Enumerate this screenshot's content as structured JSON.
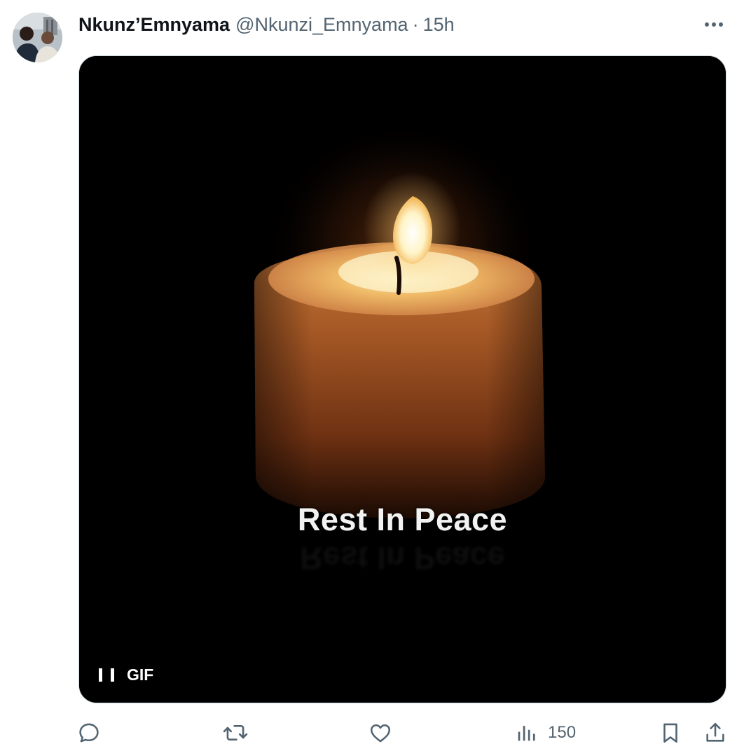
{
  "tweet": {
    "display_name": "Nkunz’Emnyama",
    "handle": "@Nkunzi_Emnyama",
    "separator": "·",
    "time": "15h"
  },
  "media": {
    "caption": "Rest In Peace",
    "badge": "GIF",
    "pause_icon": "pause-icon"
  },
  "actions": {
    "reply_icon": "reply-icon",
    "retweet_icon": "retweet-icon",
    "like_icon": "heart-icon",
    "views_icon": "bar-chart-icon",
    "views_count": "150",
    "bookmark_icon": "bookmark-icon",
    "share_icon": "share-icon"
  },
  "colors": {
    "text_primary": "#0f1419",
    "text_secondary": "#536471",
    "media_background": "#000000",
    "candle_glow": "#f0a24a"
  }
}
